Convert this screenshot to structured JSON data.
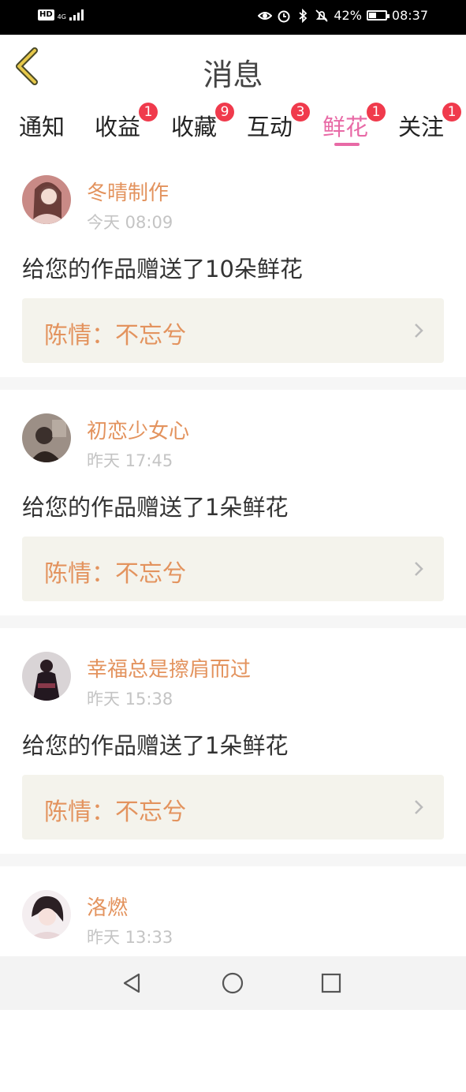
{
  "status_bar": {
    "hd_label": "HD",
    "network_label": "4G",
    "battery_text": "42%",
    "battery_level": 0.42,
    "time": "08:37",
    "icons": [
      "eye-icon",
      "alarm-icon",
      "bluetooth-icon",
      "mute-icon",
      "battery-icon"
    ]
  },
  "header": {
    "title": "消息",
    "back_icon": "chevron-left-icon",
    "accent_color": "#e6c84a"
  },
  "tabs": [
    {
      "label": "通知",
      "badge": ""
    },
    {
      "label": "收益",
      "badge": "1"
    },
    {
      "label": "收藏",
      "badge": "9"
    },
    {
      "label": "互动",
      "badge": "3"
    },
    {
      "label": "鲜花",
      "badge": "1",
      "active": true
    },
    {
      "label": "关注",
      "badge": "1"
    }
  ],
  "colors": {
    "active_tab": "#e86aa6",
    "badge": "#f03a4c",
    "username": "#e3935e",
    "work_box_bg": "#f4f3ec"
  },
  "messages": [
    {
      "username": "冬晴制作",
      "time": "今天 08:09",
      "text": "给您的作品赠送了10朵鲜花",
      "work_title": "陈情：不忘兮"
    },
    {
      "username": "初恋少女心",
      "time": "昨天 17:45",
      "text": "给您的作品赠送了1朵鲜花",
      "work_title": "陈情：不忘兮"
    },
    {
      "username": "幸福总是擦肩而过",
      "time": "昨天 15:38",
      "text": "给您的作品赠送了1朵鲜花",
      "work_title": "陈情：不忘兮"
    },
    {
      "username": "洛燃",
      "time": "昨天 13:33",
      "text": "",
      "work_title": ""
    }
  ],
  "bottom_nav": {
    "icons": [
      "back-triangle-icon",
      "home-circle-icon",
      "recents-square-icon"
    ]
  }
}
